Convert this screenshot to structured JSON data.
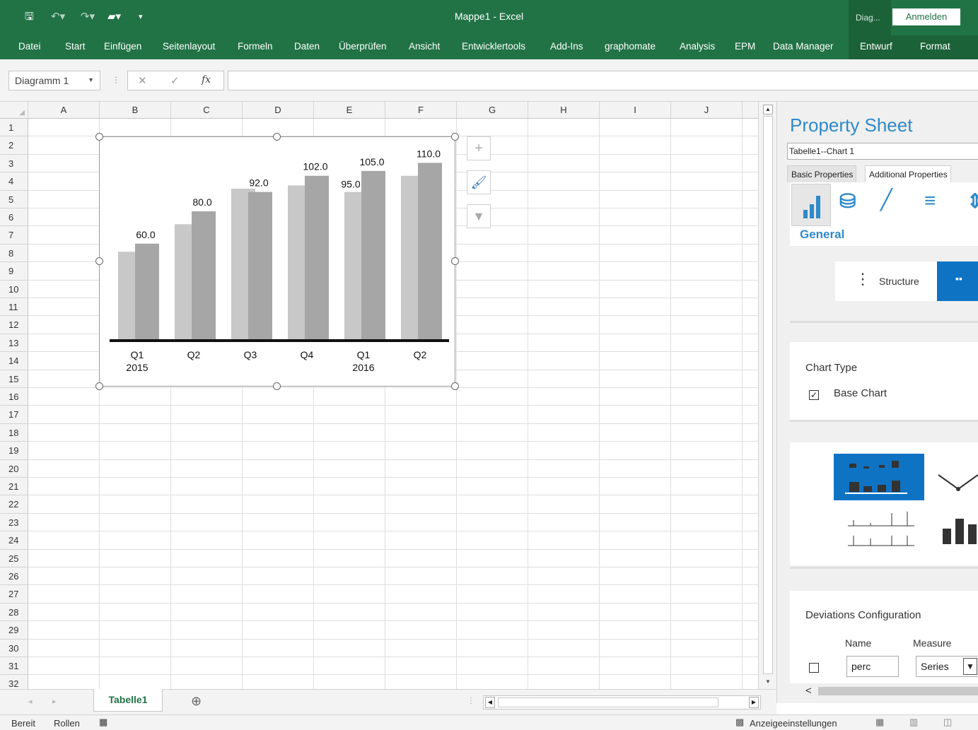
{
  "titlebar": {
    "title": "Mappe1  -  Excel",
    "context_tab": "Diag...",
    "signin_label": "Anmelden"
  },
  "ribbon": {
    "tabs": [
      "Datei",
      "Start",
      "Einfügen",
      "Seitenlayout",
      "Formeln",
      "Daten",
      "Überprüfen",
      "Ansicht",
      "Entwicklertools",
      "Add-Ins",
      "graphomate",
      "Analysis",
      "EPM",
      "Data Manager",
      "Entwurf",
      "Format"
    ]
  },
  "formula_bar": {
    "name_box": "Diagramm 1",
    "fx_label": "fx",
    "formula": ""
  },
  "grid": {
    "columns": [
      "A",
      "B",
      "C",
      "D",
      "E",
      "F",
      "G",
      "H",
      "I",
      "J"
    ],
    "rows": [
      "1",
      "2",
      "3",
      "4",
      "5",
      "6",
      "7",
      "8",
      "9",
      "10",
      "11",
      "12",
      "13",
      "14",
      "15",
      "16",
      "17",
      "18",
      "19",
      "20",
      "21",
      "22",
      "23",
      "24",
      "25",
      "26",
      "27",
      "28",
      "29",
      "30",
      "31",
      "32"
    ]
  },
  "chart_data": {
    "type": "bar",
    "categories": [
      "Q1\n2015",
      "Q2",
      "Q3",
      "Q4",
      "Q1\n2016",
      "Q2"
    ],
    "category_lines": [
      [
        "Q1",
        "2015"
      ],
      [
        "Q2",
        ""
      ],
      [
        "Q3",
        ""
      ],
      [
        "Q4",
        ""
      ],
      [
        "Q1",
        "2016"
      ],
      [
        "Q2",
        ""
      ]
    ],
    "series": [
      {
        "values": [
          55,
          72,
          94,
          96,
          92,
          102
        ]
      },
      {
        "values": [
          60.0,
          80.0,
          92.0,
          102.0,
          105.0,
          110.0
        ]
      }
    ],
    "data_labels": [
      "60.0",
      "80.0",
      "92.0",
      "102.0",
      "105.0",
      "110.0"
    ],
    "extra_label": {
      "text": "95.0",
      "category_index": 4
    },
    "ylim": [
      0,
      115
    ],
    "colors": {
      "series0": "#c8c8c8",
      "series1": "#a6a6a6",
      "axis": "#111111"
    },
    "grid": false
  },
  "chart_buttons": [
    "plus-icon",
    "brush-icon",
    "filter-icon"
  ],
  "property_sheet": {
    "title": "Property Sheet",
    "selector": "Tabelle1--Chart 1",
    "tabs": [
      "Basic Properties",
      "Additional Properties"
    ],
    "active_tab": 1,
    "general_label": "General",
    "structure_label": "Structure",
    "chart_type_title": "Chart Type",
    "base_chart_label": "Base Chart",
    "base_chart_checked": true,
    "deviations_title": "Deviations Configuration",
    "dev_headers": [
      "Name",
      "Measure"
    ],
    "dev_name_value": "perc",
    "dev_measure_value": "Series",
    "accent": "#2e8ac9",
    "selected_bg": "#0f73c4"
  },
  "sheets": {
    "tabs": [
      "Tabelle1"
    ],
    "add_icon": "⊕"
  },
  "status": {
    "ready": "Bereit",
    "scroll": "Rollen",
    "display_settings": "Anzeigeeinstellungen"
  }
}
